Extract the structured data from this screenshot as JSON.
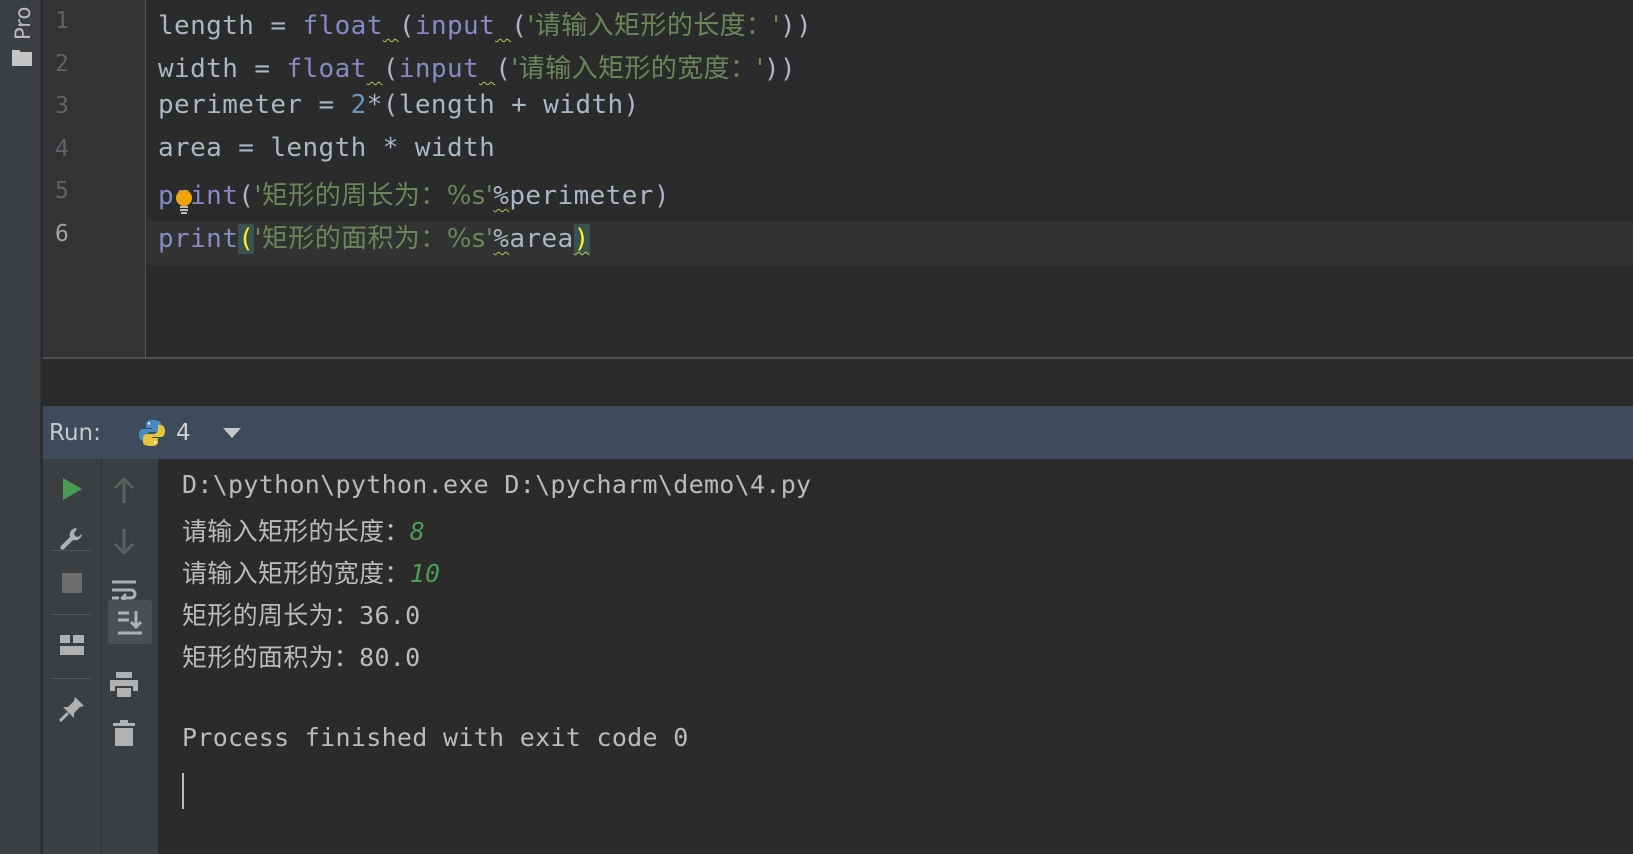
{
  "sidebar": {
    "project_tab_label": "Pro"
  },
  "editor": {
    "line_numbers": [
      "1",
      "2",
      "3",
      "4",
      "5",
      "6"
    ],
    "current_line": 6,
    "lines": [
      {
        "parts": [
          {
            "t": "length = ",
            "c": "plain"
          },
          {
            "t": "float",
            "c": "func"
          },
          {
            "t": " ",
            "c": "plain",
            "sq": true
          },
          {
            "t": "(",
            "c": "plain"
          },
          {
            "t": "input",
            "c": "func"
          },
          {
            "t": " ",
            "c": "plain",
            "sq": true
          },
          {
            "t": "(",
            "c": "plain"
          },
          {
            "t": "'请输入矩形的长度：'",
            "c": "str"
          },
          {
            "t": "))",
            "c": "plain"
          }
        ]
      },
      {
        "parts": [
          {
            "t": "width = ",
            "c": "plain"
          },
          {
            "t": "float",
            "c": "func"
          },
          {
            "t": " ",
            "c": "plain",
            "sq": true
          },
          {
            "t": "(",
            "c": "plain"
          },
          {
            "t": "input",
            "c": "func"
          },
          {
            "t": " ",
            "c": "plain",
            "sq": true
          },
          {
            "t": "(",
            "c": "plain"
          },
          {
            "t": "'请输入矩形的宽度：'",
            "c": "str"
          },
          {
            "t": "))",
            "c": "plain"
          }
        ]
      },
      {
        "parts": [
          {
            "t": "perimeter = ",
            "c": "plain"
          },
          {
            "t": "2",
            "c": "num"
          },
          {
            "t": "*(length + width)",
            "c": "plain"
          }
        ]
      },
      {
        "parts": [
          {
            "t": "area = length * width",
            "c": "plain"
          }
        ]
      },
      {
        "parts": [
          {
            "t": "print",
            "c": "func"
          },
          {
            "t": "(",
            "c": "plain"
          },
          {
            "t": "'矩形的周长为：%s'",
            "c": "str"
          },
          {
            "t": "%",
            "c": "plain",
            "sq": true
          },
          {
            "t": "perimeter)",
            "c": "plain"
          }
        ]
      },
      {
        "parts": [
          {
            "t": "print",
            "c": "func"
          },
          {
            "t": "(",
            "c": "match"
          },
          {
            "t": "'矩形的面积为：%s'",
            "c": "str"
          },
          {
            "t": "%",
            "c": "plain",
            "sq": true
          },
          {
            "t": "area",
            "c": "plain"
          },
          {
            "t": ")",
            "c": "match",
            "sq": true
          }
        ]
      }
    ]
  },
  "run_panel": {
    "label": "Run:",
    "tab_name": "4",
    "toolbar_icons_left": [
      "run-icon",
      "wrench-icon",
      "stop-icon",
      "layout-icon",
      "pin-icon"
    ],
    "toolbar_icons_right": [
      "arrow-up-icon",
      "arrow-down-icon",
      "soft-wrap-icon",
      "scroll-to-end-icon",
      "print-icon",
      "trash-icon"
    ]
  },
  "console": {
    "command": "D:\\python\\python.exe D:\\pycharm\\demo\\4.py",
    "prompt_length": "请输入矩形的长度：",
    "input_length": "8",
    "prompt_width": "请输入矩形的宽度：",
    "input_width": "10",
    "perimeter_label": "矩形的周长为：",
    "perimeter_value": "36.0",
    "area_label": "矩形的面积为：",
    "area_value": "80.0",
    "exit_message": "Process finished with exit code 0"
  },
  "colors": {
    "keyword_func": "#8888c6",
    "string": "#6a8759",
    "number": "#6897bb",
    "input_text": "#499c54",
    "run_header_bg": "#3d4b5c"
  }
}
